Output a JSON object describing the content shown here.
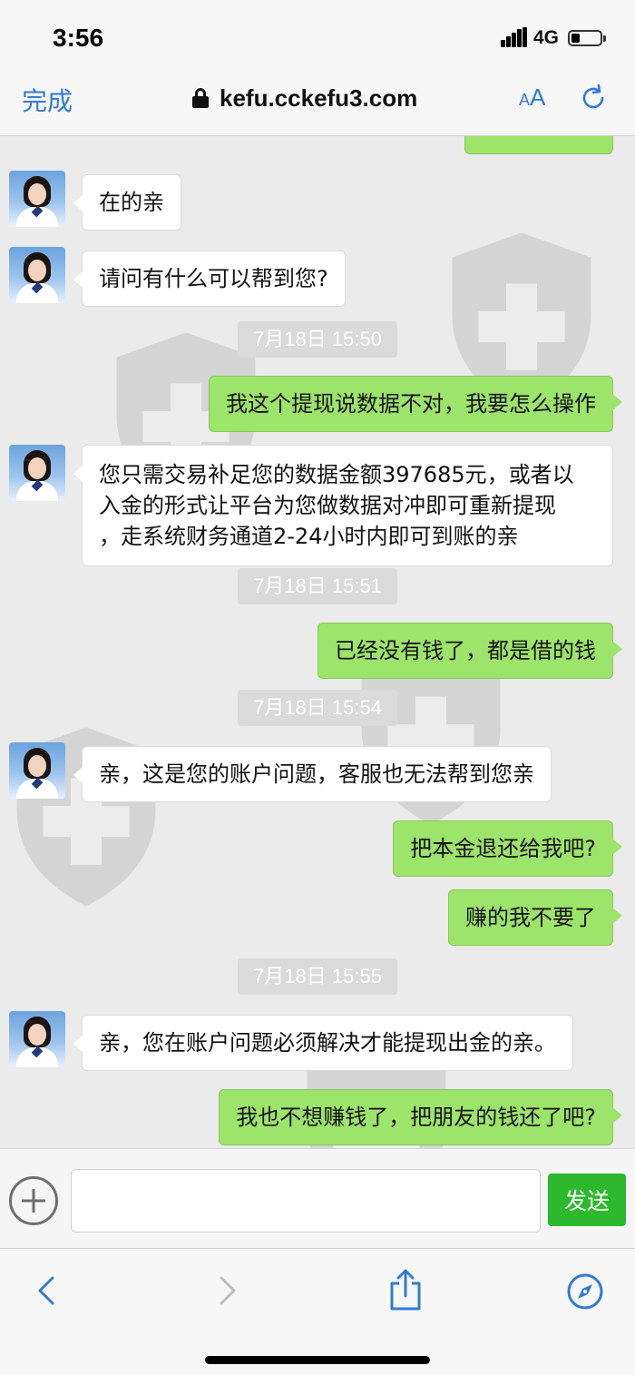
{
  "status_bar": {
    "time": "3:56",
    "network": "4G"
  },
  "browser": {
    "done_label": "完成",
    "url": "kefu.cckefu3.com",
    "text_size_small": "A",
    "text_size_large": "A"
  },
  "colors": {
    "accent_blue": "#2f7bd9",
    "sent_bubble": "#9de46a",
    "received_bubble": "#ffffff",
    "send_button": "#2db92d",
    "timestamp_bg": "#dadada"
  },
  "messages": [
    {
      "side": "left",
      "text": "在的亲"
    },
    {
      "side": "left",
      "text": "请问有什么可以帮到您?"
    },
    {
      "type": "timestamp",
      "text": "7月18日 15:50"
    },
    {
      "side": "right",
      "text": "我这个提现说数据不对，我要怎么操作"
    },
    {
      "side": "left",
      "lines": [
        "您只需交易补足您的数据金额397685元，或者以",
        "入金的形式让平台为您做数据对冲即可重新提现",
        "，走系统财务通道2-24小时内即可到账的亲"
      ]
    },
    {
      "type": "timestamp",
      "text": "7月18日 15:51"
    },
    {
      "side": "right",
      "text": "已经没有钱了，都是借的钱"
    },
    {
      "type": "timestamp",
      "text": "7月18日 15:54"
    },
    {
      "side": "left",
      "text": "亲，这是您的账户问题，客服也无法帮到您亲"
    },
    {
      "side": "right",
      "text": "把本金退还给我吧?"
    },
    {
      "side": "right",
      "text": "赚的我不要了"
    },
    {
      "type": "timestamp",
      "text": "7月18日 15:55"
    },
    {
      "side": "left",
      "text": "亲，您在账户问题必须解决才能提现出金的亲。"
    },
    {
      "side": "right",
      "text": "我也不想赚钱了，把朋友的钱还了吧?"
    }
  ],
  "input": {
    "placeholder": "",
    "send_label": "发送"
  },
  "toolbar": {
    "icons": [
      "back-icon",
      "forward-icon",
      "share-icon",
      "compass-icon"
    ]
  }
}
